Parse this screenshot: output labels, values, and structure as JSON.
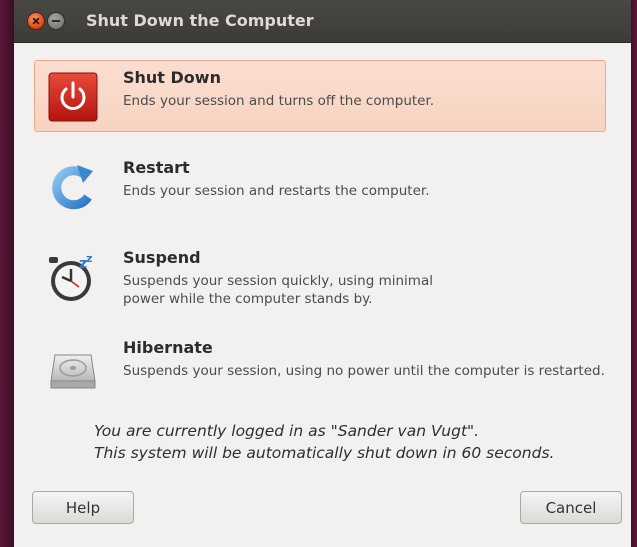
{
  "window": {
    "title": "Shut Down the Computer"
  },
  "options": [
    {
      "title": "Shut Down",
      "desc1": "Ends your session and turns off the computer.",
      "desc2": "",
      "icon": "power-icon",
      "selected": true
    },
    {
      "title": "Restart",
      "desc1": "Ends your session and restarts the computer.",
      "desc2": "",
      "icon": "restart-icon",
      "selected": false
    },
    {
      "title": "Suspend",
      "desc1": "Suspends your session quickly, using minimal",
      "desc2": "power while the computer stands by.",
      "icon": "suspend-clock-icon",
      "selected": false
    },
    {
      "title": "Hibernate",
      "desc1": "Suspends your session, using no power until the computer is restarted.",
      "desc2": "",
      "icon": "hard-drive-icon",
      "selected": false
    }
  ],
  "status": {
    "line1": "You are currently logged in as \"Sander van Vugt\".",
    "line2": "This system will be automatically shut down in 60 seconds."
  },
  "buttons": {
    "help": "Help",
    "cancel": "Cancel"
  },
  "colors": {
    "selected_bg": "#f7d3c0",
    "power_red": "#cc2222",
    "titlebar": "#3c3b37"
  }
}
